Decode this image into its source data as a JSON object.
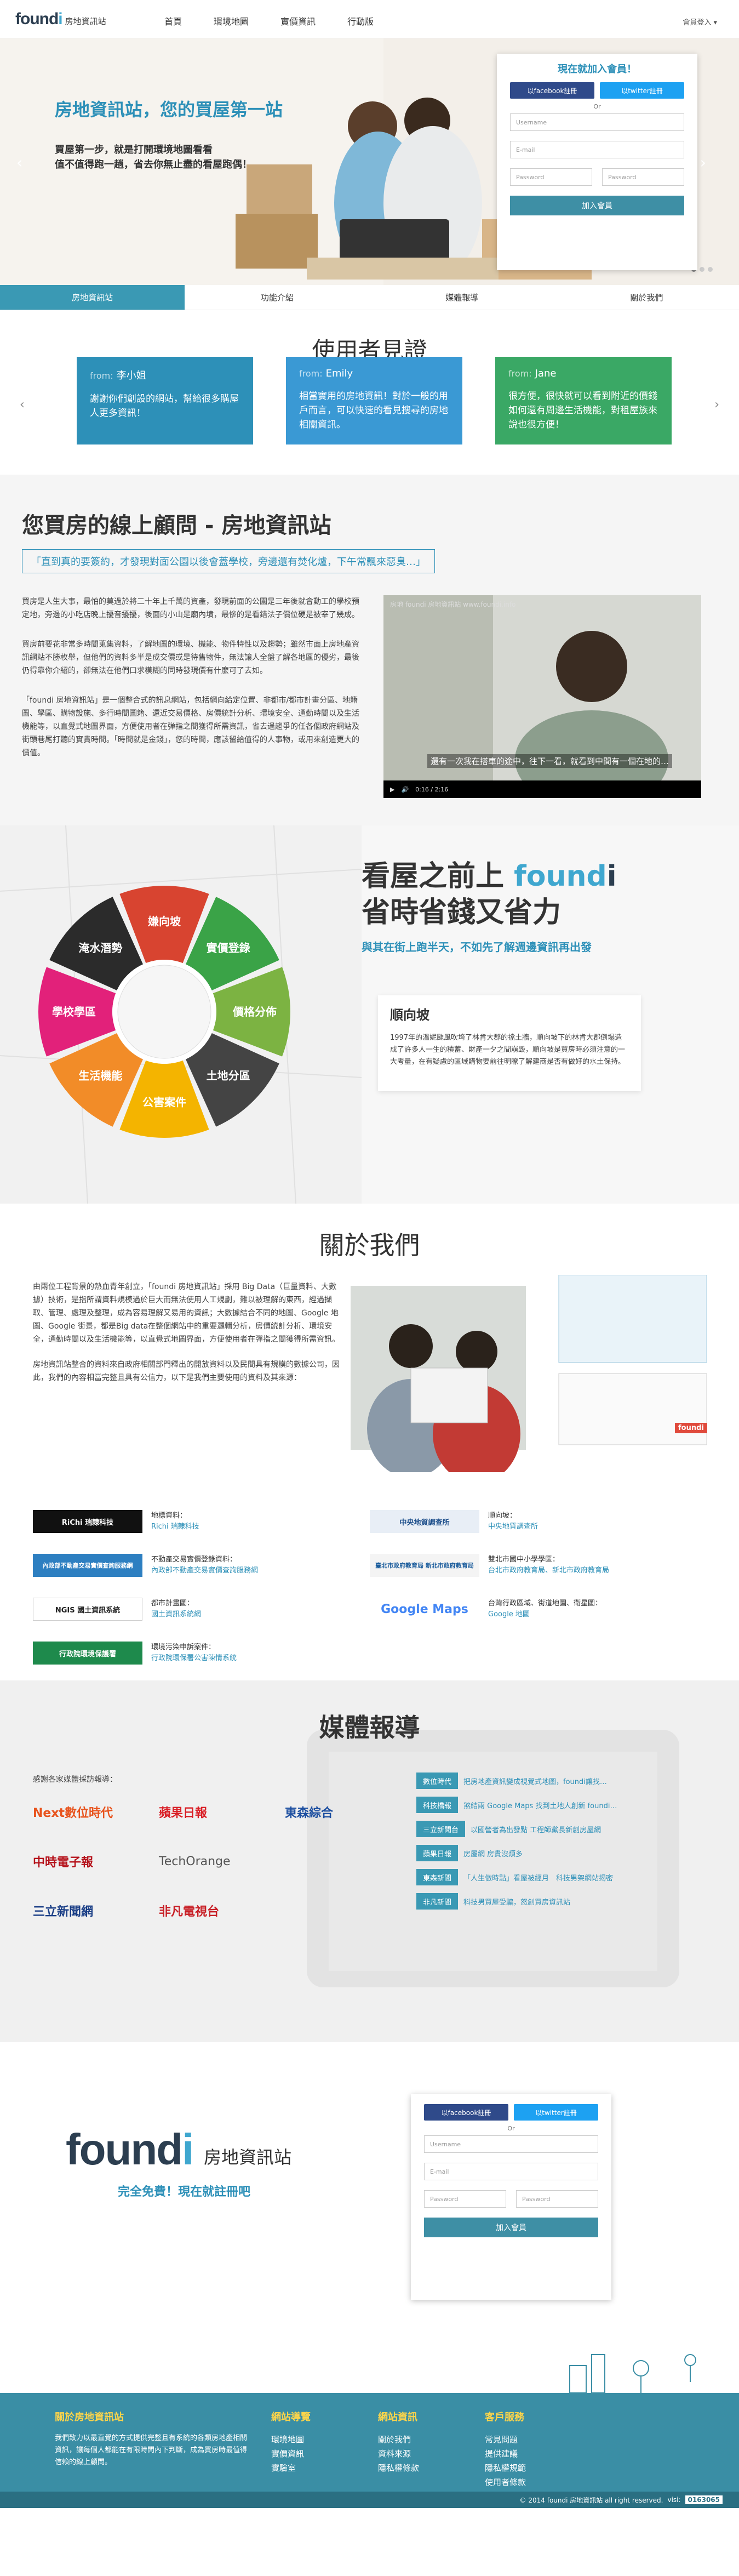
{
  "header": {
    "logo_brand_a": "found",
    "logo_brand_b": "i",
    "logo_sub": "房地資訊站",
    "nav": [
      "首頁",
      "環境地圖",
      "實價資訊",
      "行動版"
    ],
    "member": "會員登入 ▾"
  },
  "hero": {
    "title": "房地資訊站，您的買屋第一站",
    "line1": "買屋第一步，就是打開環境地圖看看",
    "line2": "值不值得跑一趟，省去你無止盡的看屋跑偶！",
    "prev": "‹",
    "next": "›"
  },
  "register": {
    "title": "現在就加入會員！",
    "facebook": "以facebook註冊",
    "twitter": "以twitter註冊",
    "or": "Or",
    "username": "Username",
    "email": "E-mail",
    "password": "Password",
    "password2": "Password",
    "join": "加入會員"
  },
  "tabs": [
    "房地資訊站",
    "功能介紹",
    "媒體報導",
    "關於我們"
  ],
  "testimonials": {
    "title": "使用者見證",
    "from": "from:",
    "items": [
      {
        "name": "李小姐",
        "text": "謝謝你們創設的網站，幫給很多購屋人更多資訊！",
        "color": "#2d90b8"
      },
      {
        "name": "Emily",
        "text": "相當實用的房地資訊！對於一般的用戶而言，可以快速的看見搜尋的房地相關資訊。",
        "color": "#3a99d4"
      },
      {
        "name": "Jane",
        "text": "很方便，很快就可以看到附近的價錢如何還有周邊生活機能，對租屋族來說也很方便！",
        "color": "#3aa865"
      }
    ]
  },
  "consult": {
    "title": "您買房的線上顧問 - 房地資訊站",
    "quote": "「直到真的要簽約，才發現對面公園以後會蓋學校，旁邊還有焚化爐，下午常飄來惡臭…」",
    "p1": "買房是人生大事，最怕的莫過於將二十年上千萬的資產，發現前面的公園是三年後就會動工的學校預定地，旁邊的小吃店晚上擾音擾擾，後面的小山是廟內墳，最慘的是看錯法子價位硬是被宰了幾成。",
    "p2": "買房前要花非常多時間蒐集資料，了解地圖的環境、機能、物件特性以及趨勢；雖然市面上房地產資訊網站不勝枚舉，但他們的資料多半是成交價或是待售物件，無法讓人全盤了解各地區的優劣，最後仍得靠你介紹的，卻無法在他們口求模糊的同時發現價有什麼可了去如。",
    "p3": "「foundi 房地資訊站」是一個整合式的訊息網站，包括網向給定位置、非都市/都市計畫分區、地籍圖、學區、購物設施、多行時間圖籍、還近交易價格、房價統計分析、環境安全、通勤時間以及生活機能等，以直覺式地圖界面，方便使用者在弹指之間獲得所需資訊，省去逞趨爭的任各個政府網站及街頭巷尾打聽的實貴時間。「時間就是金錢」，您的時間，應該留給值得的人事物，或用來創造更大的價值。",
    "video_title": "房地 foundi 房地資訊站 www.foundi.info",
    "video_caption": "還有一次我在搭車的途中，往下一看，就看到中間有一個在地的…",
    "video_time": "0:16 / 2:16"
  },
  "features": {
    "h1": "看屋之前上",
    "brand_a": "found",
    "brand_b": "i",
    "h2": "省時省錢又省力",
    "sub": "與其在街上跑半天，不如先了解週邊資訊再出發",
    "wheel": [
      "嫌向坡",
      "實價登錄",
      "價格分佈",
      "土地分區",
      "公害案件",
      "生活機能",
      "學校學區",
      "淹水潛勢"
    ],
    "card_title": "順向坡",
    "card_text": "1997年的溫妮颱風吹垮了林肯大郡的擋土牆，順向坡下的林肯大郡倒塌造成了許多人一生的積蓄、財產一夕之間崩毀，順向坡是買房時必須注意的一大考量，在有疑慮的區域購物要前往明瞭了解建商是否有做好的水土保持。"
  },
  "about": {
    "title": "關於我們",
    "p1": "由兩位工程背景的熱血青年創立，「foundi 房地資訊站」採用 Big Data（巨量資料、大數據）技術，是指所謂資料規模過於巨大而無法使用人工規劃，難以被理解的東西，經過擷取、管理、處理及整理，成為容易理解又易用的資訊；大數據結合不同的地圖、Google 地圖、Google 街景，都是Big data在整個網站中的重要邏輯分析，房價統計分析、環境安全，通勤時間以及生活機能等，以直覺式地圖界面，方便使用者在彈指之間獲得所需資訊。",
    "p2": "房地資訊站整合的資料來自政府相關部門釋出的開放資料以及民間具有規模的數據公司，因此，我們的內容相當完整且具有公信力，以下是我們主要使用的資料及其來源：",
    "sources": [
      {
        "logo": "RiChi 瑞隸科技",
        "label": "地標資料：",
        "src": "Richi 瑞隸科技"
      },
      {
        "logo": "中央地質調查所",
        "label": "順向坡：",
        "src": "中央地質調查所"
      },
      {
        "logo": "內政部不動產交易實價查詢服務網",
        "label": "不動產交易實價登錄資料：",
        "src": "內政部不動產交易實價查詢服務網"
      },
      {
        "logo": "臺北市政府教育局 新北市政府教育局",
        "label": "雙北市國中小學學區：",
        "src": "台北市政府教育局、新北市政府教育局"
      },
      {
        "logo": "NGIS 國土資訊系統",
        "label": "都市計畫圖：",
        "src": "國土資訊系統網"
      },
      {
        "logo": "Google Maps",
        "label": "台灣行政區域、街道地圖、衛星圖：",
        "src": "Google 地圖"
      },
      {
        "logo": "行政院環境保護署",
        "label": "環境污染申訴案件：",
        "src": "行政院環保署公害陳情系統"
      }
    ],
    "screen_brand": "foundi"
  },
  "media": {
    "title": "媒體報導",
    "thanks": "感謝各家媒體採訪報導：",
    "logos": [
      "Next數位時代",
      "蘋果日報",
      "東森綜合",
      "中時電子報",
      "TechOrange",
      "",
      "三立新聞網",
      "非凡電視台",
      ""
    ],
    "items": [
      {
        "tag": "數位時代",
        "text": "把房地產資訊變成視覺式地圖，foundi讓找…"
      },
      {
        "tag": "科技橋報",
        "text": "煞結兩 Google Maps 找到土地人創新 foundi…"
      },
      {
        "tag": "三立新聞台",
        "text": "以國營者為出發點 工程師黨長新創房屋網"
      },
      {
        "tag": "蘋果日報",
        "text": "房屬網 房貴沒煩多"
      },
      {
        "tag": "東森新聞",
        "text": "「人生做時點」看屋被經月　科技男架網站揭密"
      },
      {
        "tag": "非凡新聞",
        "text": "科技男買屋受騙，怒創買房資訊站"
      }
    ]
  },
  "signup": {
    "brand_a": "found",
    "brand_b": "i",
    "sub": "房地資訊站",
    "cta": "完全免費！現在就註冊吧",
    "facebook": "以facebook註冊",
    "twitter": "以twitter註冊",
    "or": "Or",
    "username": "Username",
    "email": "E-mail",
    "password": "Password",
    "password2": "Password",
    "join": "加入會員"
  },
  "footer": {
    "about_title": "關於房地資訊站",
    "about_text": "我們致力以最直覺的方式提供完整且有系統的各類房地產相關資訊，讓每個人都能在有限時間內下判斷，成為買房時最值得信賴的線上顧問。",
    "cols": [
      {
        "title": "網站導覽",
        "items": [
          "環境地圖",
          "實價資訊",
          "實驗室"
        ]
      },
      {
        "title": "網站資訊",
        "items": [
          "關於我們",
          "資料來源",
          "隱私權條款"
        ]
      },
      {
        "title": "客戶服務",
        "items": [
          "常見問題",
          "提供建議",
          "隱私權規範",
          "使用者條款"
        ]
      }
    ],
    "copyright": "© 2014 foundi 房地資訊站 all right reserved.",
    "visits_label": "visi:",
    "visits": "0163065"
  }
}
